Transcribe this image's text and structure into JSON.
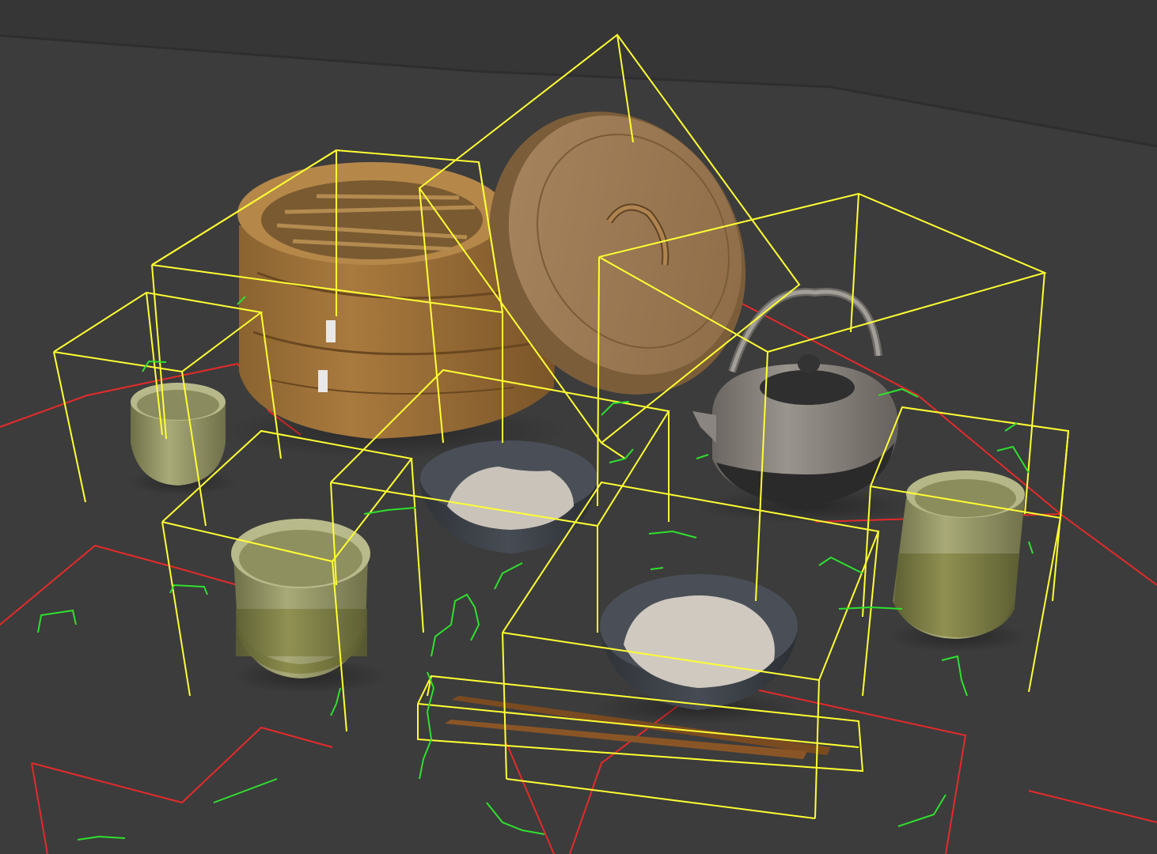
{
  "viewport": {
    "label": "",
    "background_color": "#3c3c3c",
    "backdrop_color": "#363636",
    "selection_color": "#ffff33",
    "gizmo_red": "#e52a2a",
    "gizmo_green": "#2fe02f"
  },
  "scene_objects": [
    {
      "name": "bamboo-steamer-base",
      "type": "steamer"
    },
    {
      "name": "bamboo-steamer-lid",
      "type": "lid"
    },
    {
      "name": "cast-iron-teapot",
      "type": "teapot"
    },
    {
      "name": "tea-cup-small",
      "type": "cup"
    },
    {
      "name": "tea-cup-front-left",
      "type": "cup"
    },
    {
      "name": "tea-cup-right",
      "type": "cup"
    },
    {
      "name": "rice-bowl-back",
      "type": "bowl"
    },
    {
      "name": "rice-bowl-front",
      "type": "bowl"
    },
    {
      "name": "chopsticks",
      "type": "chopsticks"
    }
  ]
}
